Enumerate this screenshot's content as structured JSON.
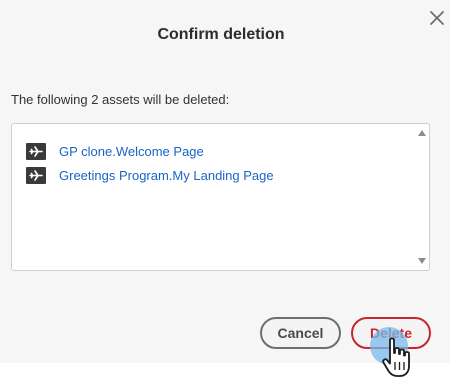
{
  "dialog": {
    "title": "Confirm deletion",
    "message": "The following 2 assets will be deleted:",
    "assets": [
      {
        "label": "GP clone.Welcome Page",
        "icon": "landing-page-icon"
      },
      {
        "label": "Greetings Program.My Landing Page",
        "icon": "landing-page-icon"
      }
    ],
    "cancel_label": "Cancel",
    "delete_label": "Delete",
    "close_icon": "close-icon"
  },
  "colors": {
    "dialog_background": "#f6f6f6",
    "link": "#1a64c8",
    "delete_accent": "#c9252d",
    "click_highlight": "#78b9eb"
  }
}
